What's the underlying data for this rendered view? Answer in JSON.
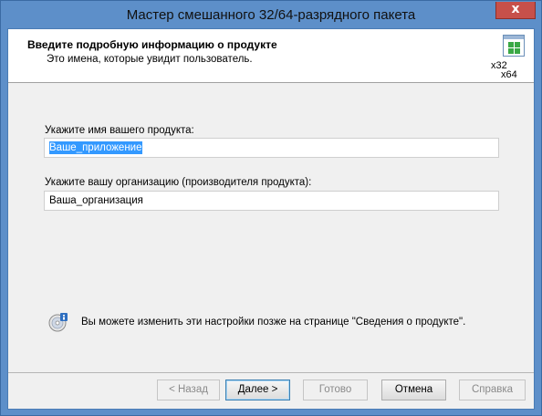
{
  "window": {
    "title": "Мастер смешанного 32/64-разрядного пакета",
    "close_label": "x"
  },
  "header": {
    "title": "Введите подробную информацию о продукте",
    "subtitle": "Это имена, которые увидит пользователь.",
    "icon_label_32": "x32",
    "icon_label_64": "x64"
  },
  "form": {
    "product_label": "Укажите имя вашего продукта:",
    "product_value": "Ваше_приложение",
    "org_label": "Укажите вашу организацию (производителя продукта):",
    "org_value": "Ваша_организация"
  },
  "info": {
    "text": "Вы можете изменить эти настройки позже на странице \"Сведения о продукте\"."
  },
  "buttons": {
    "back": "< Назад",
    "next": "Далее >",
    "finish": "Готово",
    "cancel": "Отмена",
    "help": "Справка"
  }
}
